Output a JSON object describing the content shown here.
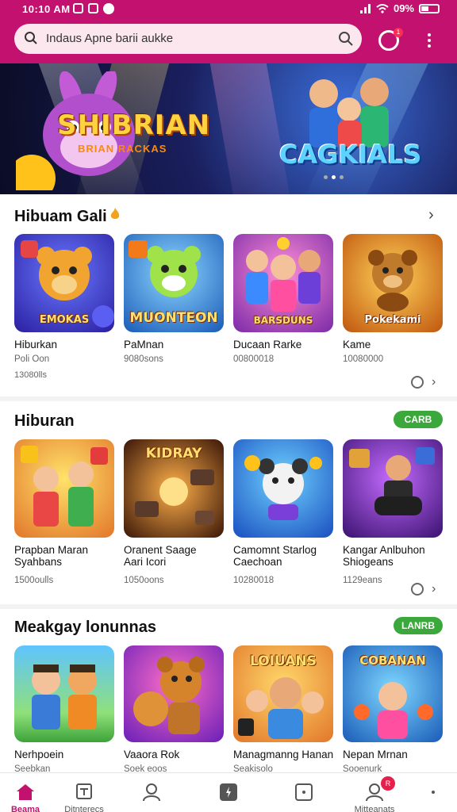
{
  "status_bar": {
    "time": "10:10 AM",
    "battery": "09%"
  },
  "header": {
    "search_placeholder": "Indaus Apne barii aukke",
    "notification_count": "1"
  },
  "banner": {
    "title_left": "SHIBRIAN",
    "subtitle_left": "BRIAN RACKAS",
    "title_right": "CAGKIALS",
    "slides": 3,
    "active_slide": 1
  },
  "sections": [
    {
      "title": "Hibuam Gali",
      "action": "chevron",
      "cards": [
        {
          "tile_label": "EMOKAS",
          "name": "Hiburkan",
          "meta1": "Poli Oon",
          "meta2": "13080lls"
        },
        {
          "tile_label": "MUONTEON",
          "name": "PaMnan",
          "meta1": "9080sons",
          "meta2": ""
        },
        {
          "tile_label": "BARSDUNS",
          "name": "Ducaan Rarke",
          "meta1": "00800018",
          "meta2": ""
        },
        {
          "tile_label": "Pokekami",
          "name": "Kame",
          "meta1": "10080000",
          "meta2": ""
        }
      ]
    },
    {
      "title": "Hiburan",
      "action": "CARB",
      "cards": [
        {
          "tile_label": "",
          "name": "Prapban Maran",
          "name2": "Syahbans",
          "meta1": "1500oulls"
        },
        {
          "tile_label": "KIDRAY",
          "name": "Oranent Saage",
          "name2": "Aari Icori",
          "meta1": "1050oons"
        },
        {
          "tile_label": "",
          "name": "Camomnt Starlog",
          "name2": "Caechoan",
          "meta1": "10280018"
        },
        {
          "tile_label": "",
          "name": "Kangar Anlbuhon",
          "name2": "Shiogeans",
          "meta1": "1129eans"
        }
      ]
    },
    {
      "title": "Meakgay lonunnas",
      "action": "LANRB",
      "cards": [
        {
          "tile_label": "",
          "name": "Nerhpoein",
          "meta1": "Seebkan"
        },
        {
          "tile_label": "",
          "name": "Vaaora Rok",
          "meta1": "Soek eoos"
        },
        {
          "tile_label": "LOIUANS",
          "name": "Managmanng Hanan",
          "meta1": "Seakisolo"
        },
        {
          "tile_label": "COBANAN",
          "name": "Nepan Mrnan",
          "meta1": "Sooenurk"
        }
      ]
    }
  ],
  "bottom_nav": [
    {
      "label": "Beama",
      "icon": "home-icon",
      "active": true
    },
    {
      "label": "Ditnterecs",
      "icon": "library-icon",
      "active": false
    },
    {
      "label": "",
      "icon": "profile-icon",
      "active": false
    },
    {
      "label": "",
      "icon": "games-icon",
      "active": false
    },
    {
      "label": "",
      "icon": "apps-icon",
      "active": false
    },
    {
      "label": "Mitteanats",
      "icon": "account-icon",
      "active": false,
      "badge": "R"
    }
  ],
  "colors": {
    "brand": "#c2116e",
    "pill": "#3aa83a"
  }
}
